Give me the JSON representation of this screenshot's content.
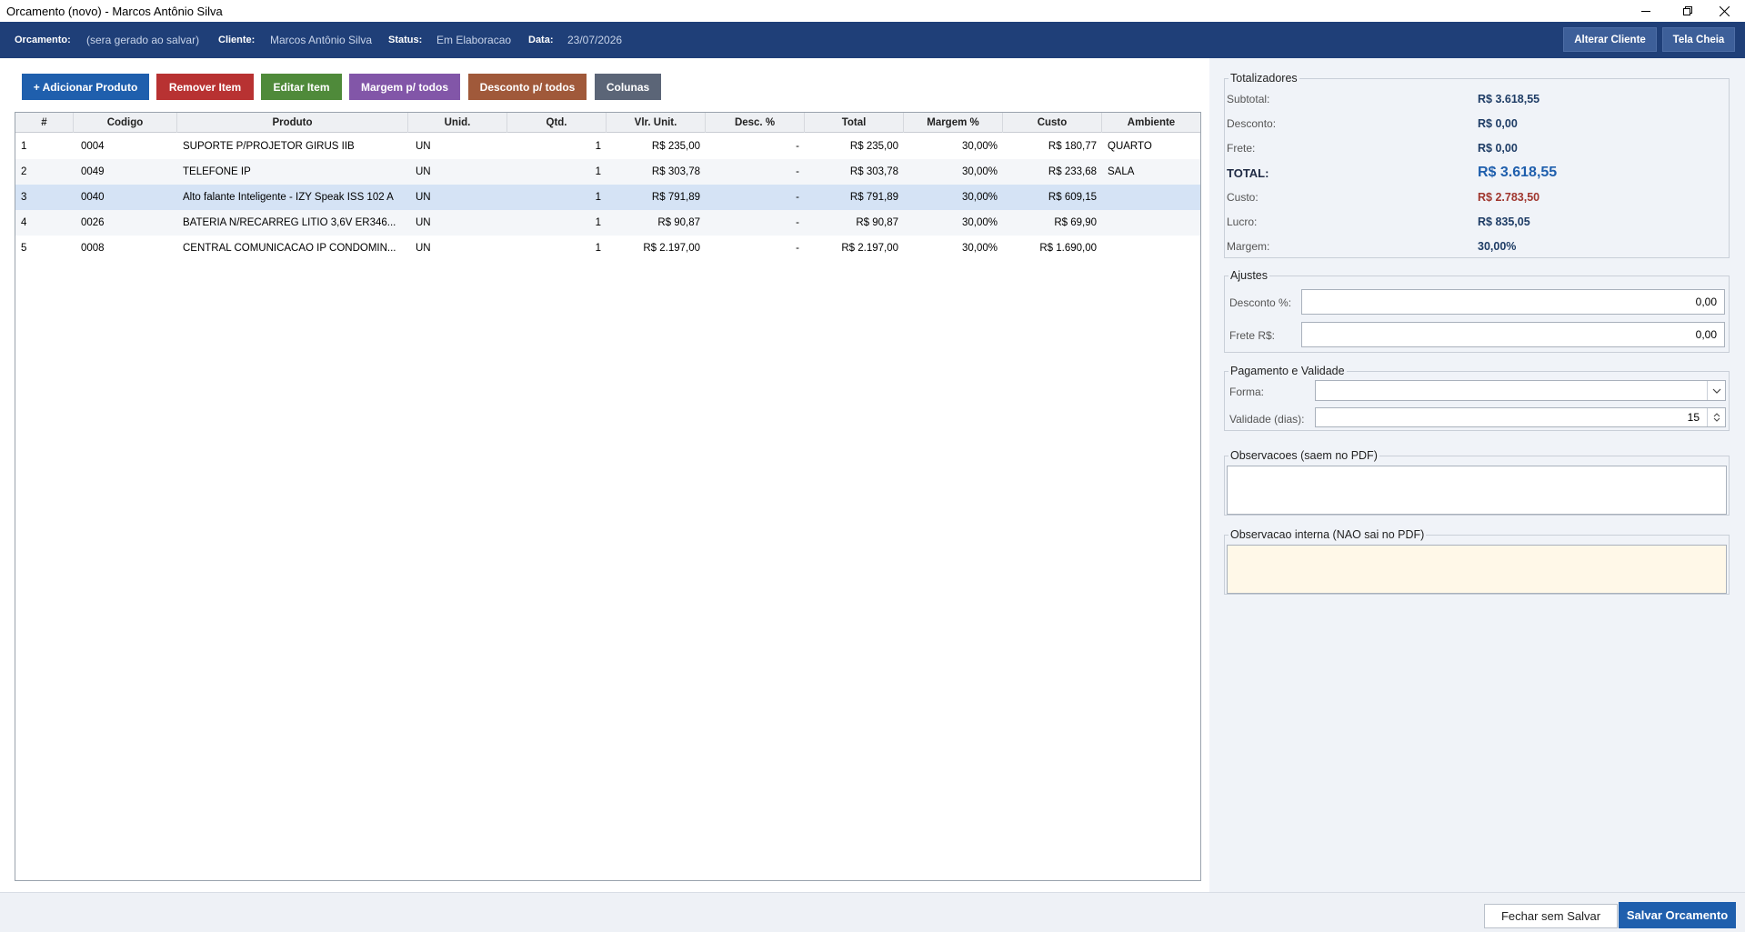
{
  "window": {
    "title": "Orcamento (novo) - Marcos Antônio Silva"
  },
  "header": {
    "orcamento_label": "Orcamento:",
    "orcamento_value": "(sera gerado ao salvar)",
    "cliente_label": "Cliente:",
    "cliente_value": "Marcos Antônio Silva",
    "status_label": "Status:",
    "status_value": "Em Elaboracao",
    "data_label": "Data:",
    "data_value": "23/07/2026",
    "alterar_cliente": "Alterar Cliente",
    "tela_cheia": "Tela Cheia"
  },
  "toolbar": {
    "add": "+ Adicionar Produto",
    "remove": "Remover Item",
    "edit": "Editar Item",
    "margin": "Margem p/ todos",
    "discount": "Desconto p/ todos",
    "columns": "Colunas"
  },
  "colors": {
    "header_bg": "#1f3f78",
    "add": "#1f5fad",
    "remove": "#b83232",
    "edit": "#4f8a3a",
    "margin": "#8256a8",
    "discount": "#a0593a",
    "columns": "#5b6577",
    "selected_row": "#d5e3f5",
    "total_value": "#1f5fad",
    "custo_value": "#a0362e",
    "save_button": "#1f5fad"
  },
  "table": {
    "columns": [
      "#",
      "Codigo",
      "Produto",
      "Unid.",
      "Qtd.",
      "Vlr. Unit.",
      "Desc. %",
      "Total",
      "Margem %",
      "Custo",
      "Ambiente"
    ],
    "selected_index": 2,
    "rows": [
      [
        "1",
        "0004",
        "SUPORTE P/PROJETOR GIRUS IIB",
        "UN",
        "1",
        "R$ 235,00",
        "-",
        "R$ 235,00",
        "30,00%",
        "R$ 180,77",
        "QUARTO"
      ],
      [
        "2",
        "0049",
        "TELEFONE IP",
        "UN",
        "1",
        "R$ 303,78",
        "-",
        "R$ 303,78",
        "30,00%",
        "R$ 233,68",
        "SALA"
      ],
      [
        "3",
        "0040",
        "Alto falante Inteligente - IZY Speak ISS 102 A",
        "UN",
        "1",
        "R$ 791,89",
        "-",
        "R$ 791,89",
        "30,00%",
        "R$ 609,15",
        ""
      ],
      [
        "4",
        "0026",
        "BATERIA N/RECARREG LITIO 3,6V ER346...",
        "UN",
        "1",
        "R$ 90,87",
        "-",
        "R$ 90,87",
        "30,00%",
        "R$ 69,90",
        ""
      ],
      [
        "5",
        "0008",
        "CENTRAL COMUNICACAO IP CONDOMIN...",
        "UN",
        "1",
        "R$ 2.197,00",
        "-",
        "R$ 2.197,00",
        "30,00%",
        "R$ 1.690,00",
        ""
      ]
    ]
  },
  "totalizadores": {
    "title": "Totalizadores",
    "subtotal_label": "Subtotal:",
    "subtotal": "R$ 3.618,55",
    "desconto_label": "Desconto:",
    "desconto": "R$ 0,00",
    "frete_label": "Frete:",
    "frete": "R$ 0,00",
    "total_label": "TOTAL:",
    "total": "R$ 3.618,55",
    "custo_label": "Custo:",
    "custo": "R$ 2.783,50",
    "lucro_label": "Lucro:",
    "lucro": "R$ 835,05",
    "margem_label": "Margem:",
    "margem": "30,00%"
  },
  "ajustes": {
    "title": "Ajustes",
    "desconto_label": "Desconto %:",
    "desconto_value": "0,00",
    "frete_label": "Frete R$:",
    "frete_value": "0,00"
  },
  "pagamento": {
    "title": "Pagamento e Validade",
    "forma_label": "Forma:",
    "forma_value": "",
    "validade_label": "Validade (dias):",
    "validade_value": "15"
  },
  "observacoes": {
    "title": "Observacoes (saem no PDF)",
    "value": ""
  },
  "observacao_interna": {
    "title": "Observacao interna (NAO sai no PDF)",
    "value": ""
  },
  "footer": {
    "close": "Fechar sem Salvar",
    "save": "Salvar Orcamento"
  }
}
